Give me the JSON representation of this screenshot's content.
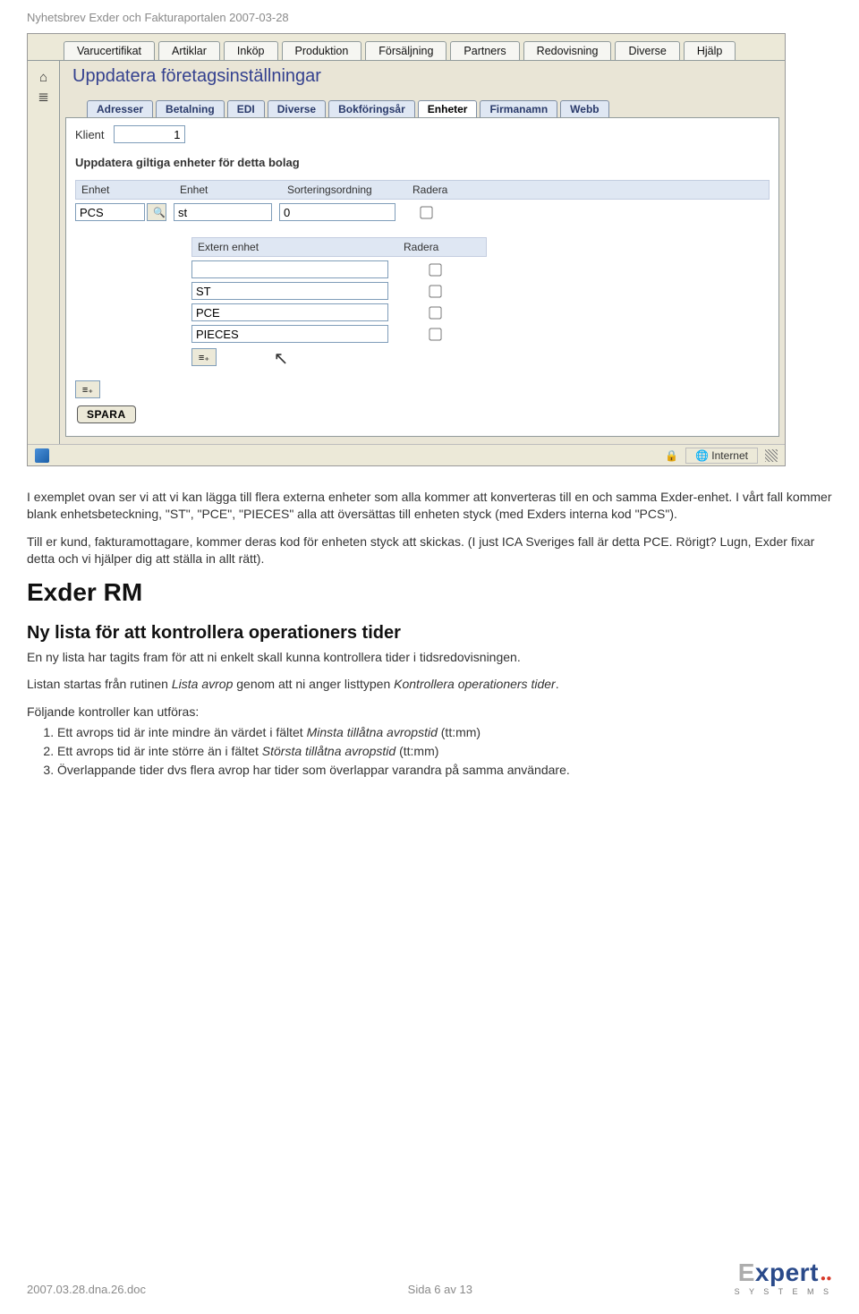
{
  "doc": {
    "header": "Nyhetsbrev Exder och Fakturaportalen 2007-03-28",
    "footer_left": "2007.03.28.dna.26.doc",
    "footer_center": "Sida 6 av 13",
    "logo_text": "Expert",
    "logo_sub": "S Y S T E M S"
  },
  "screenshot": {
    "top_tabs": [
      "Varucertifikat",
      "Artiklar",
      "Inköp",
      "Produktion",
      "Försäljning",
      "Partners",
      "Redovisning",
      "Diverse",
      "Hjälp"
    ],
    "panel_title": "Uppdatera företagsinställningar",
    "inner_tabs": [
      "Adresser",
      "Betalning",
      "EDI",
      "Diverse",
      "Bokföringsår",
      "Enheter",
      "Firmanamn",
      "Webb"
    ],
    "active_inner_tab": "Enheter",
    "klient_label": "Klient",
    "klient_value": "1",
    "section_head": "Uppdatera giltiga enheter för detta bolag",
    "cols": {
      "unit1": "Enhet",
      "unit2": "Enhet",
      "sort": "Sorteringsordning",
      "rad": "Radera"
    },
    "row1": {
      "unit": "PCS",
      "unit2": "st",
      "sort": "0"
    },
    "sub_cols": {
      "ext": "Extern enhet",
      "rad": "Radera"
    },
    "sub_rows": [
      "",
      "ST",
      "PCE",
      "PIECES"
    ],
    "spara": "SPARA",
    "status": {
      "zone_label": "Internet"
    }
  },
  "text": {
    "p1": "I exemplet ovan ser vi att vi kan lägga till flera externa enheter som alla kommer att konverteras till en och samma Exder-enhet. I vårt fall kommer blank enhetsbeteckning, \"ST\", \"PCE\", \"PIECES\" alla att översättas till enheten styck (med Exders interna kod \"PCS\").",
    "p2": "Till er kund, fakturamottagare, kommer deras kod för enheten styck att skickas. (I just ICA Sveriges fall är detta PCE. Rörigt? Lugn, Exder fixar detta och vi hjälper dig att ställa in allt rätt).",
    "h1": "Exder RM",
    "h2": "Ny lista för att kontrollera operationers tider",
    "p3": "En ny lista har tagits fram för att ni enkelt skall kunna kontrollera tider i tidsredovisningen.",
    "p4_a": "Listan startas från rutinen ",
    "p4_i1": "Lista avrop",
    "p4_b": " genom att ni anger listtypen ",
    "p4_i2": "Kontrollera operationers tider",
    "p4_c": ".",
    "p5": "Följande kontroller kan utföras:",
    "li1_a": "Ett avrops tid är inte mindre än värdet i fältet ",
    "li1_i": "Minsta tillåtna avropstid",
    "li1_b": " (tt:mm)",
    "li2_a": "Ett avrops tid är inte större än i fältet ",
    "li2_i": "Största tillåtna avropstid",
    "li2_b": " (tt:mm)",
    "li3": "Överlappande tider dvs flera avrop har tider som överlappar varandra på samma användare."
  }
}
